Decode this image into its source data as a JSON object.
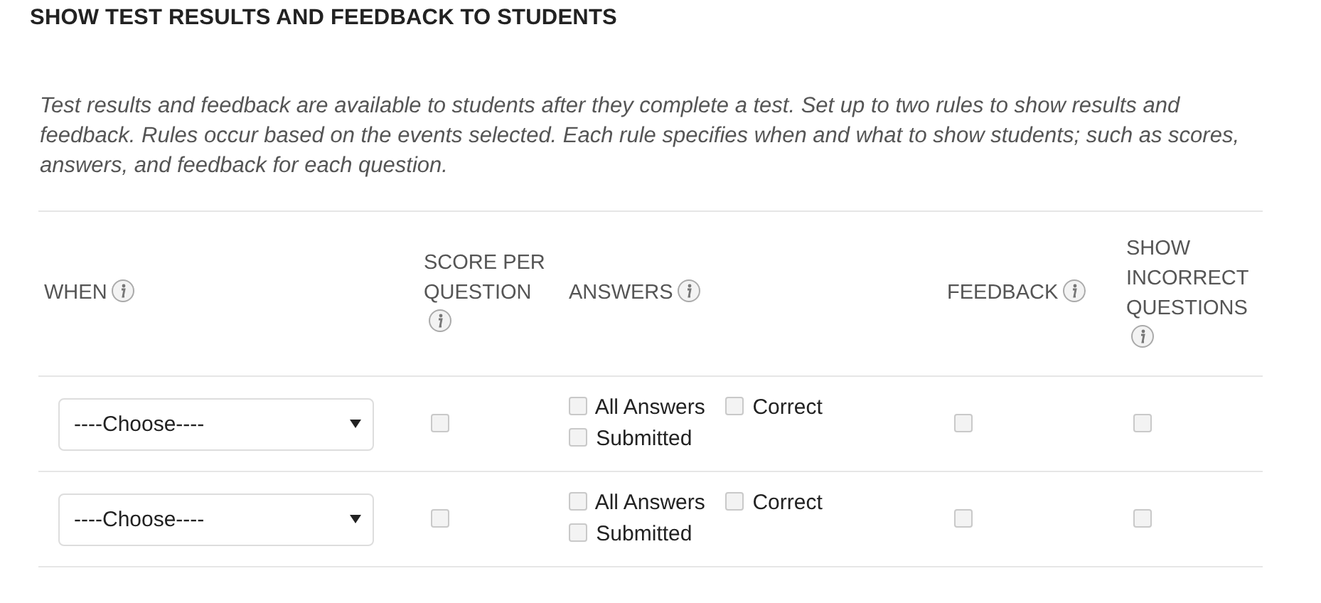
{
  "title": "SHOW TEST RESULTS AND FEEDBACK TO STUDENTS",
  "description": "Test results and feedback are available to students after they complete a test. Set up to two rules to show results and feedback. Rules occur based on the events selected. Each rule specifies when and what to show students; such as scores, answers, and feedback for each question.",
  "table": {
    "columns": [
      {
        "label": "WHEN",
        "info": true
      },
      {
        "label": "SCORE PER QUESTION",
        "info": true
      },
      {
        "label": "ANSWERS",
        "info": true
      },
      {
        "label": "FEEDBACK",
        "info": true
      },
      {
        "label": "SHOW INCORRECT QUESTIONS",
        "info": true
      }
    ],
    "rows": [
      {
        "when": {
          "value": "----Choose----"
        },
        "score_per_question": {
          "checked": false
        },
        "answers": [
          {
            "label": "All Answers",
            "checked": false
          },
          {
            "label": "Correct",
            "checked": false
          },
          {
            "label": "Submitted",
            "checked": false
          }
        ],
        "feedback": {
          "checked": false
        },
        "show_incorrect_questions": {
          "checked": false
        }
      },
      {
        "when": {
          "value": "----Choose----"
        },
        "score_per_question": {
          "checked": false
        },
        "answers": [
          {
            "label": "All Answers",
            "checked": false
          },
          {
            "label": "Correct",
            "checked": false
          },
          {
            "label": "Submitted",
            "checked": false
          }
        ],
        "feedback": {
          "checked": false
        },
        "show_incorrect_questions": {
          "checked": false
        }
      }
    ]
  }
}
